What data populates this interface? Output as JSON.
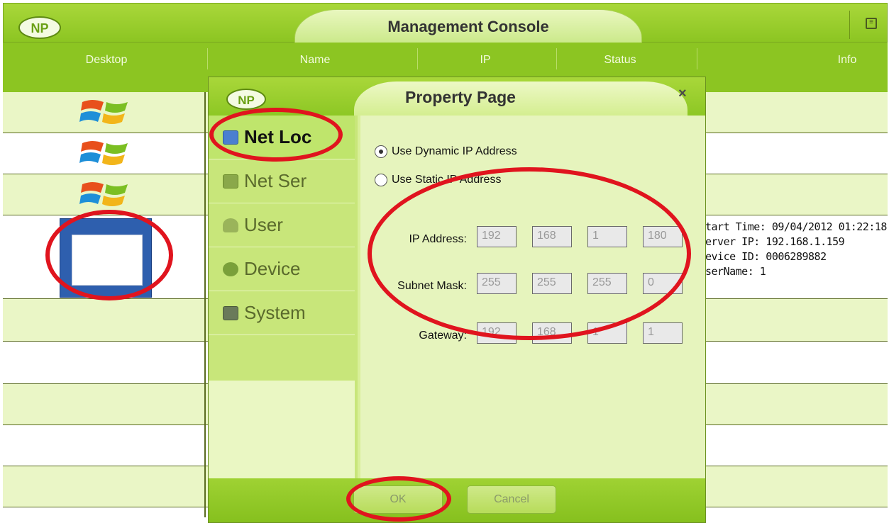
{
  "app": {
    "title": "Management Console",
    "logo_text": "NP"
  },
  "columns": [
    "Desktop",
    "Name",
    "IP",
    "Status",
    "Info"
  ],
  "rows": {
    "info_lines": [
      "tart Time: 09/04/2012 01:22:18",
      "erver IP: 192.168.1.159",
      "evice ID: 0006289882",
      "serName: 1"
    ]
  },
  "dialog": {
    "title": "Property Page",
    "logo_text": "NP",
    "close_icon": "×",
    "sidebar": [
      {
        "label": "Net Loc",
        "icon": "network-location-icon",
        "active": true
      },
      {
        "label": "Net Ser",
        "icon": "network-server-icon",
        "active": false
      },
      {
        "label": "User",
        "icon": "user-icon",
        "active": false
      },
      {
        "label": "Device",
        "icon": "device-icon",
        "active": false
      },
      {
        "label": "System",
        "icon": "system-icon",
        "active": false
      }
    ],
    "radio_dynamic": "Use Dynamic IP Address",
    "radio_static": "Use Static IP Address",
    "ip_label": "IP Address:",
    "subnet_label": "Subnet Mask:",
    "gateway_label": "Gateway:",
    "ip": [
      "192",
      "168",
      "1",
      "180"
    ],
    "subnet": [
      "255",
      "255",
      "255",
      "0"
    ],
    "gateway": [
      "192",
      "168",
      "1",
      "1"
    ],
    "ok_label": "OK",
    "cancel_label": "Cancel"
  },
  "colors": {
    "accent": "#8cc522",
    "annotation": "#e0141e"
  }
}
